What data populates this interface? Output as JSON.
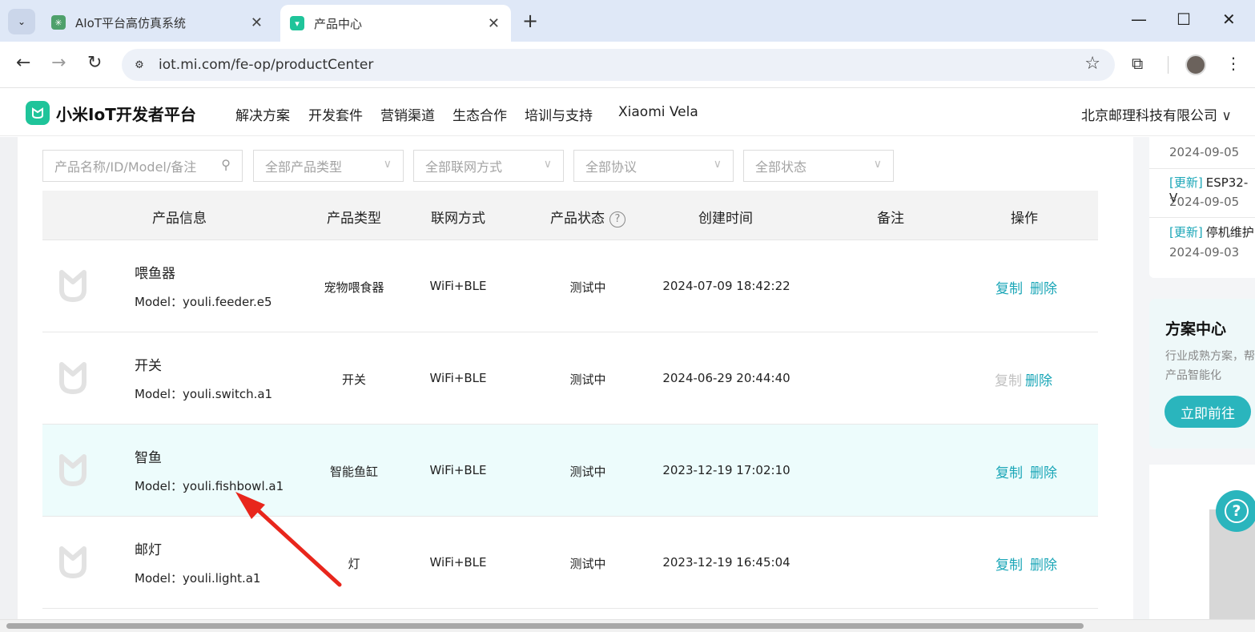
{
  "browser": {
    "tabs": [
      {
        "title": "AIoT平台高仿真系统",
        "active": false
      },
      {
        "title": "产品中心",
        "active": true
      }
    ],
    "new_tab_symbol": "+",
    "url": "iot.mi.com/fe-op/productCenter"
  },
  "header": {
    "brand": "小米IoT开发者平台",
    "nav": [
      "解决方案",
      "开发套件",
      "营销渠道",
      "生态合作",
      "培训与支持",
      "Xiaomi Vela"
    ],
    "company": "北京邮理科技有限公司"
  },
  "filters": {
    "search_placeholder": "产品名称/ID/Model/备注",
    "type": "全部产品类型",
    "network": "全部联网方式",
    "protocol": "全部协议",
    "status": "全部状态"
  },
  "table": {
    "headers": [
      "产品信息",
      "产品类型",
      "联网方式",
      "产品状态",
      "创建时间",
      "备注",
      "操作"
    ],
    "model_prefix": "Model：",
    "rows": [
      {
        "name": "喂鱼器",
        "model": "youli.feeder.e5",
        "type": "宠物喂食器",
        "network": "WiFi+BLE",
        "status": "测试中",
        "created": "2024-07-09 18:42:22",
        "note": "",
        "copy": "复制",
        "delete": "删除",
        "copy_enabled": true,
        "highlighted": false
      },
      {
        "name": "开关",
        "model": "youli.switch.a1",
        "type": "开关",
        "network": "WiFi+BLE",
        "status": "测试中",
        "created": "2024-06-29 20:44:40",
        "note": "",
        "copy": "复制",
        "delete": "删除",
        "copy_enabled": false,
        "highlighted": false
      },
      {
        "name": "智鱼",
        "model": "youli.fishbowl.a1",
        "type": "智能鱼缸",
        "network": "WiFi+BLE",
        "status": "测试中",
        "created": "2023-12-19 17:02:10",
        "note": "",
        "copy": "复制",
        "delete": "删除",
        "copy_enabled": true,
        "highlighted": true
      },
      {
        "name": "邮灯",
        "model": "youli.light.a1",
        "type": "灯",
        "network": "WiFi+BLE",
        "status": "测试中",
        "created": "2023-12-19 16:45:04",
        "note": "",
        "copy": "复制",
        "delete": "删除",
        "copy_enabled": true,
        "highlighted": false
      }
    ]
  },
  "sidebar": {
    "news": [
      {
        "tag": "",
        "text": "",
        "date": "2024-09-05"
      },
      {
        "tag": "[更新]",
        "text": "ESP32-V",
        "date": "2024-09-05"
      },
      {
        "tag": "[更新]",
        "text": "停机维护",
        "date": "2024-09-03"
      }
    ],
    "solution": {
      "title": "方案中心",
      "line1": "行业成熟方案，帮",
      "line2": "产品智能化",
      "button": "立即前往"
    }
  },
  "colors": {
    "accent": "#2ab5bd",
    "link": "#1aa6b7",
    "brand_green": "#1fc49a",
    "highlight_row": "#edfcfc",
    "annotation_arrow": "#e8261c"
  }
}
